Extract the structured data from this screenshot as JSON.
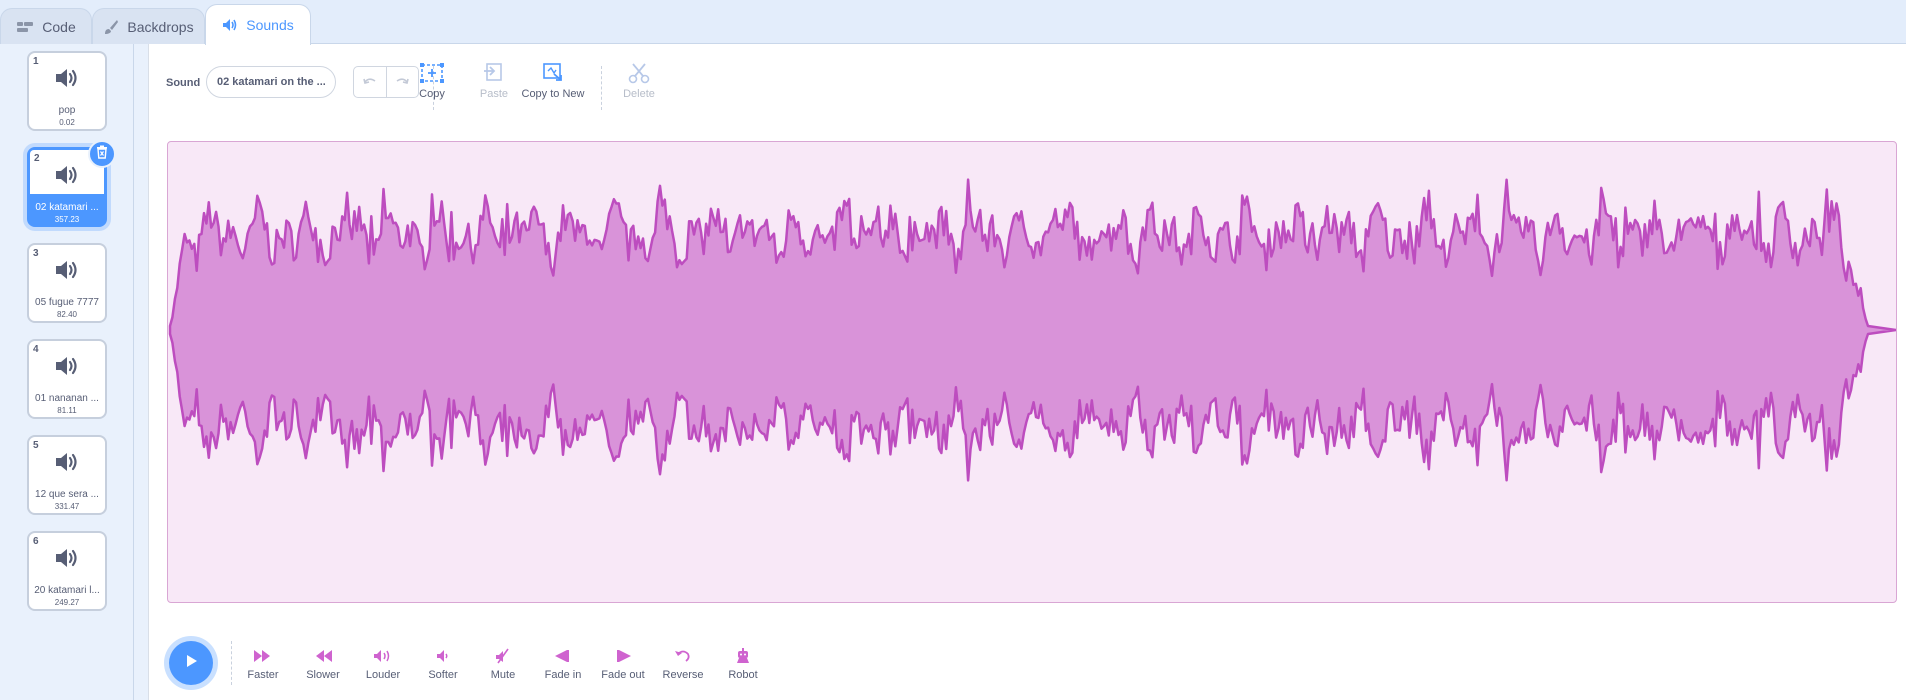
{
  "tabs": [
    {
      "label": "Code",
      "icon": "code-icon"
    },
    {
      "label": "Backdrops",
      "icon": "paintbrush-icon"
    },
    {
      "label": "Sounds",
      "icon": "speaker-icon",
      "active": true
    }
  ],
  "sounds": [
    {
      "num": "1",
      "name": "pop",
      "duration": "0.02"
    },
    {
      "num": "2",
      "name": "02 katamari ...",
      "duration": "357.23",
      "selected": true
    },
    {
      "num": "3",
      "name": "05 fugue 7777",
      "duration": "82.40"
    },
    {
      "num": "4",
      "name": "01 nananan ...",
      "duration": "81.11"
    },
    {
      "num": "5",
      "name": "12 que sera ...",
      "duration": "331.47"
    },
    {
      "num": "6",
      "name": "20 katamari l...",
      "duration": "249.27"
    }
  ],
  "editor": {
    "sound_label": "Sound",
    "sound_name_value": "02 katamari on the ...",
    "toolbar": {
      "copy": "Copy",
      "paste": "Paste",
      "copy_to_new": "Copy to New",
      "delete": "Delete"
    },
    "effects": [
      "Faster",
      "Slower",
      "Louder",
      "Softer",
      "Mute",
      "Fade in",
      "Fade out",
      "Reverse",
      "Robot"
    ]
  },
  "colors": {
    "accent": "#4c97ff",
    "wave_fill": "#d993d9",
    "wave_stroke": "#bd4dbf",
    "wave_bg": "#f8e8f7"
  }
}
